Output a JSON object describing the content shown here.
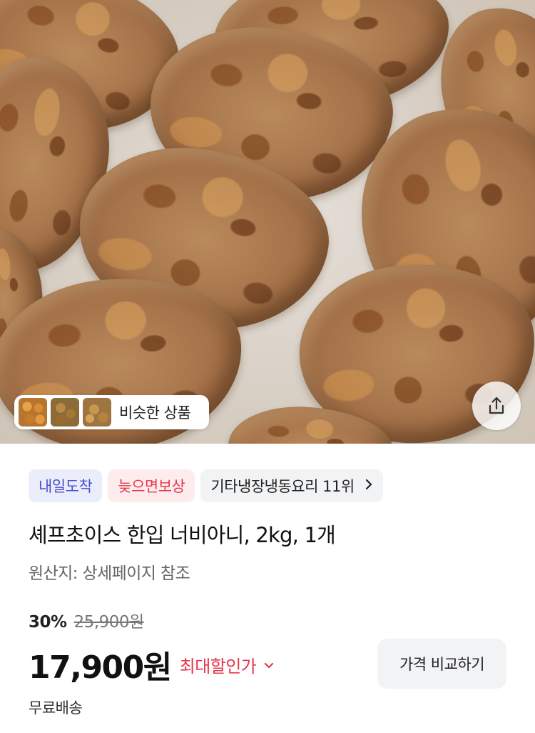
{
  "product_image": {
    "icon": "product-photo"
  },
  "similar_products": {
    "label": "비슷한 상품",
    "thumbnails": [
      "thumbnail-1",
      "thumbnail-2",
      "thumbnail-3"
    ]
  },
  "share": {
    "icon": "share-icon"
  },
  "badges": {
    "arrival": "내일도착",
    "compensation": "늦으면보상",
    "ranking": "기타냉장냉동요리 11위"
  },
  "product": {
    "title": "셰프초이스 한입 너비아니, 2kg, 1개",
    "origin": "원산지: 상세페이지 참조"
  },
  "pricing": {
    "discount_rate": "30%",
    "original_price": "25,900원",
    "sale_price": "17,900원",
    "max_discount_label": "최대할인가",
    "compare_button": "가격 비교하기"
  },
  "shipping": {
    "label": "무료배송"
  },
  "colors": {
    "accent_red": "#e8364b",
    "accent_blue": "#4a4fd0"
  }
}
